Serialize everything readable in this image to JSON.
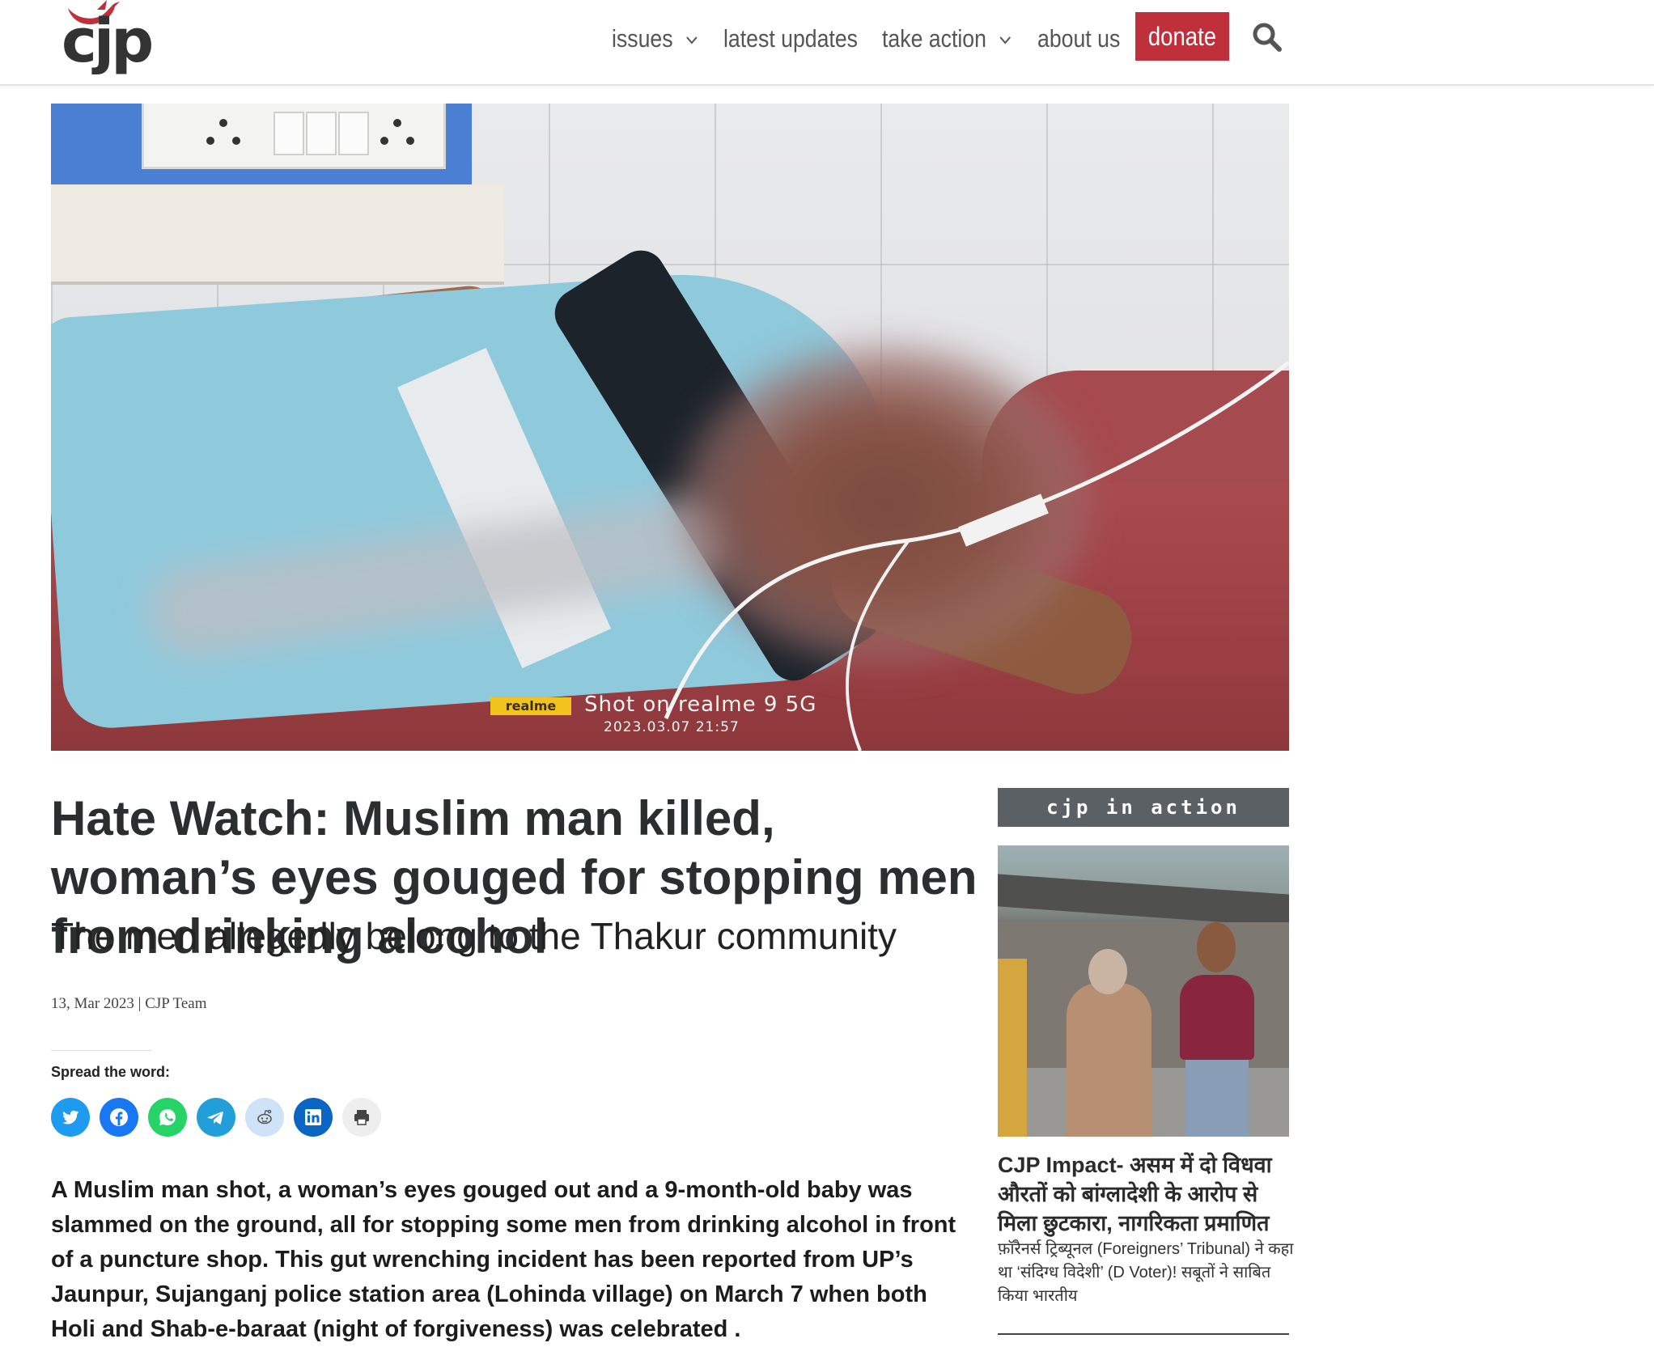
{
  "header": {
    "logo_text": "cjp",
    "nav": [
      {
        "label": "issues",
        "has_dropdown": true
      },
      {
        "label": "latest updates",
        "has_dropdown": false
      },
      {
        "label": "take action",
        "has_dropdown": true
      },
      {
        "label": "about us",
        "has_dropdown": false
      }
    ],
    "donate_label": "donate",
    "donate_color": "#c0303b",
    "search_icon": "search-icon"
  },
  "hero": {
    "watermark_badge": "realme",
    "watermark_text": "Shot on realme 9 5G",
    "watermark_date": "2023.03.07 21:57"
  },
  "article": {
    "title": "Hate Watch: Muslim man killed, woman’s eyes gouged for stopping men from drinking alcohol",
    "subtitle": "The men allegedly belong to the Thakur community",
    "meta": "13, Mar 2023 | CJP Team",
    "spread_label": "Spread the word:",
    "share": [
      {
        "name": "twitter",
        "color": "#1d9bf0"
      },
      {
        "name": "facebook",
        "color": "#1877f2"
      },
      {
        "name": "whatsapp",
        "color": "#25d366"
      },
      {
        "name": "telegram",
        "color": "#229ed9"
      },
      {
        "name": "reddit",
        "color": "#cee3f8"
      },
      {
        "name": "linkedin",
        "color": "#0a66c2"
      },
      {
        "name": "print",
        "color": "#eeeeee"
      }
    ],
    "body": "A Muslim man shot, a woman’s eyes gouged out and a 9-month-old baby was slammed on the ground, all for stopping some men from drinking alcohol in front of a puncture shop. This gut wrenching incident has been reported from UP’s Jaunpur, Sujanganj police station area (Lohinda village) on March 7 when both Holi and Shab-e-baraat (night of forgiveness) was celebrated ."
  },
  "sidebar": {
    "heading": "cjp in action",
    "card_title": "CJP Impact- असम में दो विधवा औरतों को बांग्लादेशी के आरोप से मिला छुटकारा, नागरिकता प्रमाणित",
    "card_excerpt": "फ़ॉरैनर्स ट्रिब्यूनल (Foreigners’ Tribunal) ने कहा था ‘संदिग्ध विदेशी’ (D Voter)! सबूतों ने साबित किया भारतीय"
  }
}
